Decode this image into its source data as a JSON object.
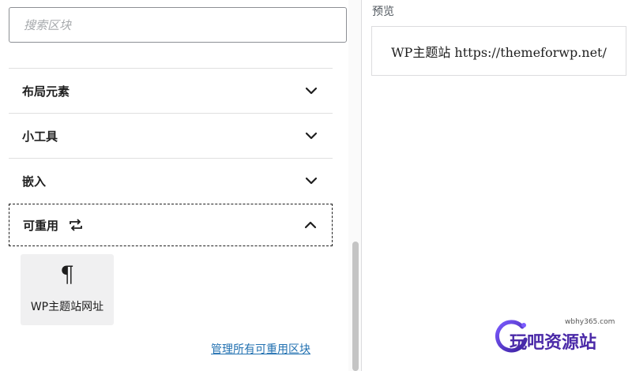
{
  "search": {
    "placeholder": "搜索区块"
  },
  "sections": [
    {
      "title": "布局元素",
      "state": "collapsed"
    },
    {
      "title": "小工具",
      "state": "collapsed"
    },
    {
      "title": "嵌入",
      "state": "collapsed"
    },
    {
      "title": "可重用",
      "state": "expanded"
    }
  ],
  "reusable": {
    "block": {
      "icon": "¶",
      "label": "WP主题站网址"
    },
    "manage_link": "管理所有可重用区块"
  },
  "preview": {
    "title": "预览",
    "content": "WP主题站 https://themeforwp.net/"
  },
  "watermark": {
    "url": "wbhy365.com",
    "text": "玩吧资源站"
  },
  "colors": {
    "link": "#2271b1",
    "text": "#1e1e1e",
    "tile_bg": "#f0f0f1",
    "watermark": "#4b2aa8"
  }
}
